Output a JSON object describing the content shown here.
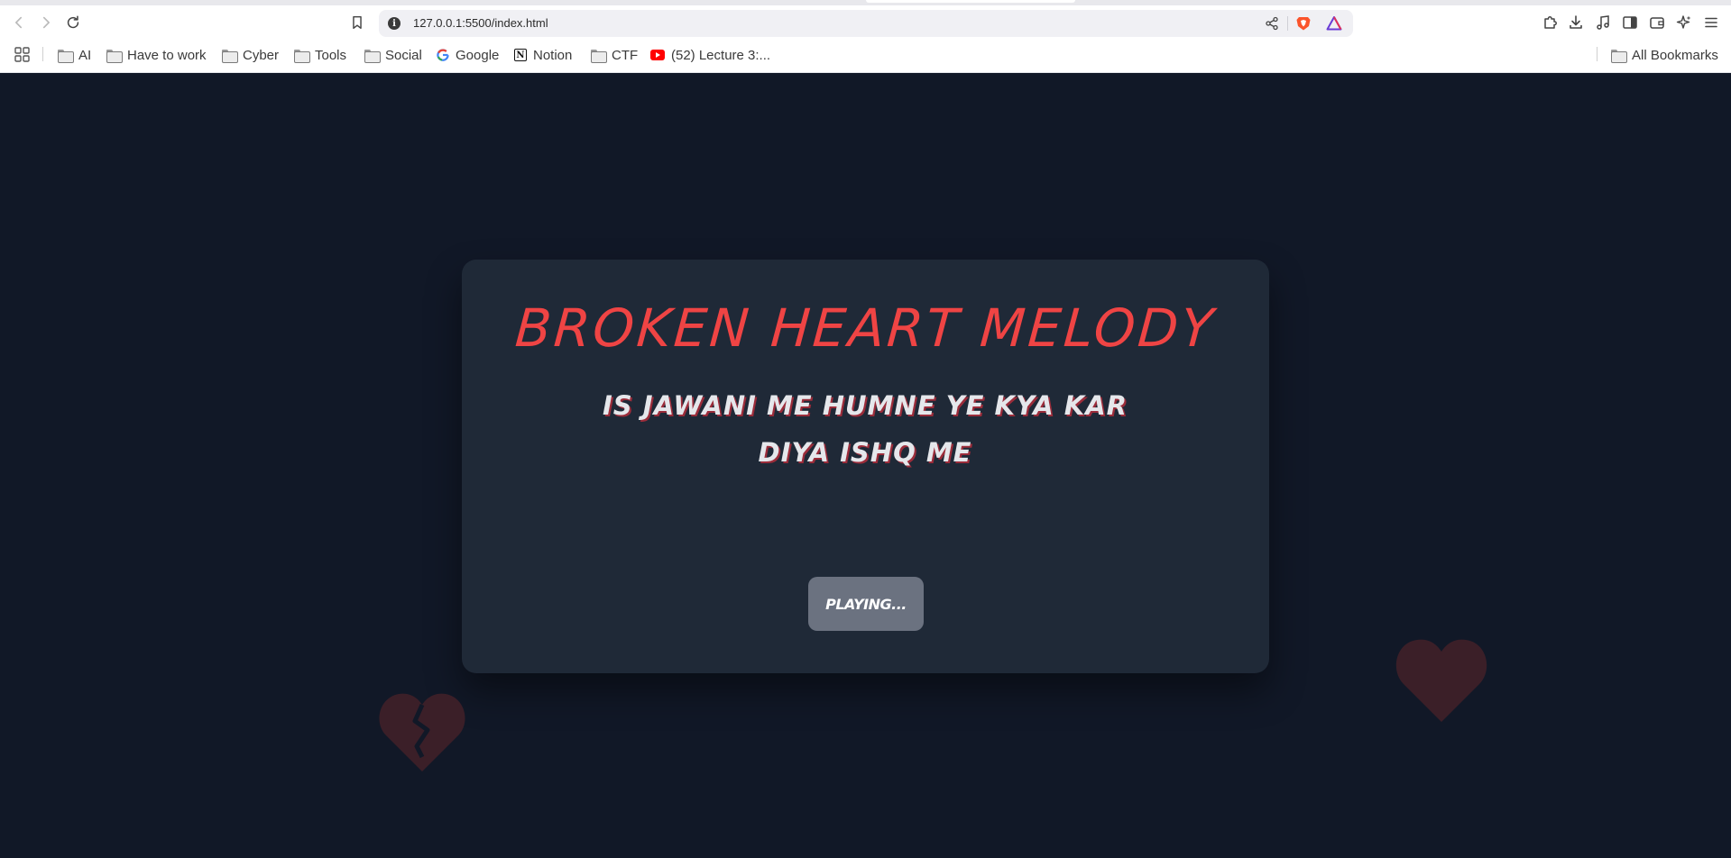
{
  "browser": {
    "url": "127.0.0.1:5500/index.html",
    "bookmarks": [
      {
        "label": "AI",
        "type": "folder"
      },
      {
        "label": "Have to work",
        "type": "folder"
      },
      {
        "label": "Cyber",
        "type": "folder"
      },
      {
        "label": "Tools",
        "type": "folder"
      },
      {
        "label": "Social",
        "type": "folder"
      },
      {
        "label": "Google",
        "type": "site",
        "icon": "google-icon"
      },
      {
        "label": "Notion",
        "type": "site",
        "icon": "notion-icon"
      },
      {
        "label": "CTF",
        "type": "folder"
      },
      {
        "label": "(52) Lecture 3:...",
        "type": "site",
        "icon": "youtube-icon"
      }
    ],
    "all_bookmarks_label": "All Bookmarks"
  },
  "page": {
    "title": "BROKEN HEART MELODY",
    "lyric": "IS JAWANI ME HUMNE YE KYA KAR DIYA ISHQ ME",
    "play_button_label": "PLAYING..."
  },
  "colors": {
    "page_bg": "#111827",
    "card_bg": "#1f2937",
    "title": "#ef4444",
    "button": "#6b7280",
    "heart": "#3b1f28"
  }
}
